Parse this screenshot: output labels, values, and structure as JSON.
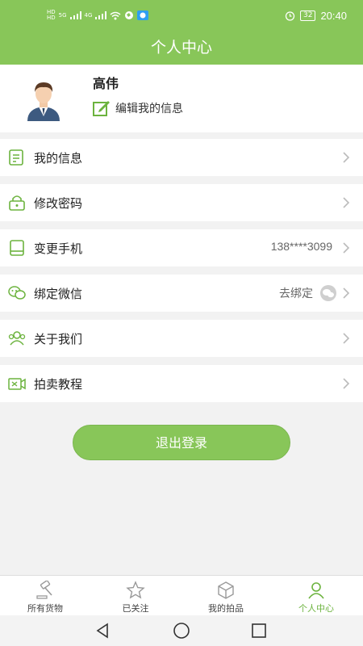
{
  "status_bar": {
    "left_badges": [
      "HD",
      "HD",
      "5G",
      "4G"
    ],
    "battery": "32",
    "time": "20:40"
  },
  "header": {
    "title": "个人中心"
  },
  "profile": {
    "name": "高伟",
    "edit_label": "编辑我的信息"
  },
  "menu": [
    {
      "label": "我的信息",
      "value": "",
      "icon": "document-icon"
    },
    {
      "label": "修改密码",
      "value": "",
      "icon": "lock-icon"
    },
    {
      "label": "变更手机",
      "value": "138****3099",
      "icon": "phone-icon"
    },
    {
      "label": "绑定微信",
      "value": "去绑定",
      "icon": "wechat-icon"
    },
    {
      "label": "关于我们",
      "value": "",
      "icon": "people-icon"
    },
    {
      "label": "拍卖教程",
      "value": "",
      "icon": "video-icon"
    }
  ],
  "logout_label": "退出登录",
  "tabs": [
    {
      "label": "所有货物",
      "icon": "gavel-icon",
      "active": false
    },
    {
      "label": "已关注",
      "icon": "star-icon",
      "active": false
    },
    {
      "label": "我的拍品",
      "icon": "box-icon",
      "active": false
    },
    {
      "label": "个人中心",
      "icon": "person-icon",
      "active": true
    }
  ],
  "colors": {
    "brand": "#88c659",
    "active_tab": "#6cb33e",
    "background": "#f2f2f2"
  }
}
